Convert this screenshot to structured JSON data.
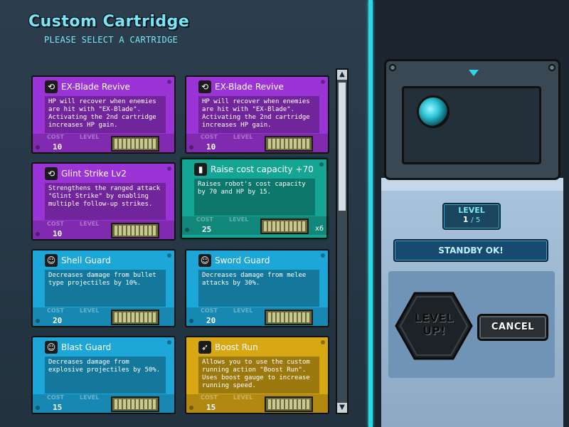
{
  "header": {
    "title": "Custom Cartridge",
    "subtitle": "PLEASE SELECT A CARTRIDGE"
  },
  "labels": {
    "cost": "COST",
    "level": "LEVEL"
  },
  "cartridges": [
    {
      "name": "EX-Blade Revive",
      "description": "HP will recover when enemies are hit with \"EX-Blade\". Activating the 2nd cartridge increases HP gain.",
      "cost": "10",
      "color": "#9b34d6",
      "icon": "blade-icon",
      "quantity": ""
    },
    {
      "name": "EX-Blade Revive",
      "description": "HP will recover when enemies are hit with \"EX-Blade\". Activating the 2nd cartridge increases HP gain.",
      "cost": "10",
      "color": "#9b34d6",
      "icon": "blade-icon",
      "quantity": ""
    },
    {
      "name": "Glint Strike Lv2",
      "description": "Strengthens the ranged attack \"Glint Strike\" by enabling multiple follow-up strikes.",
      "cost": "10",
      "color": "#9b34d6",
      "icon": "blade-icon",
      "quantity": ""
    },
    {
      "name": "Raise cost capacity +70",
      "description": "Raises robot's cost capacity by 70 and HP by 15.",
      "cost": "25",
      "color": "#14a595",
      "icon": "battery-icon",
      "quantity": "x6"
    },
    {
      "name": "Shell Guard",
      "description": "Decreases damage from bullet type projectiles by 10%.",
      "cost": "20",
      "color": "#1da6d8",
      "icon": "robot-face-icon",
      "quantity": ""
    },
    {
      "name": "Sword Guard",
      "description": "Decreases damage from melee attacks by 30%.",
      "cost": "20",
      "color": "#1da6d8",
      "icon": "robot-face-icon",
      "quantity": ""
    },
    {
      "name": "Blast Guard",
      "description": "Decreases damage from explosive projectiles by 50%.",
      "cost": "15",
      "color": "#1da6d8",
      "icon": "robot-face-icon",
      "quantity": ""
    },
    {
      "name": "Boost Run",
      "description": "Allows you to use the custom running action \"Boost Run\". Uses boost gauge to increase running speed.",
      "cost": "15",
      "color": "#d8a814",
      "icon": "boot-icon",
      "quantity": ""
    }
  ],
  "device": {
    "level_label": "LEVEL",
    "level_current": "1",
    "level_max": "/ 5",
    "status": "STANDBY OK!",
    "level_up_line1": "LEVEL",
    "level_up_line2": "UP!",
    "cancel_label": "CANCEL",
    "accent": "#2fd6e6"
  }
}
